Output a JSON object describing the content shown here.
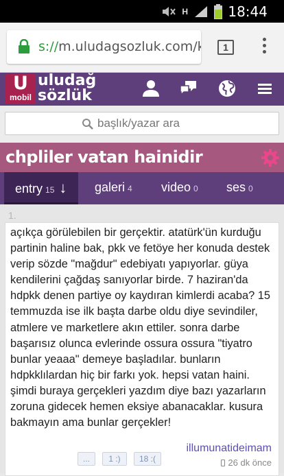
{
  "status_bar": {
    "time": "18:44",
    "network": "H"
  },
  "browser": {
    "url_scheme": "s://",
    "url_rest": "m.uludagsozluk.com/k",
    "tab_count": "1"
  },
  "site": {
    "logo_letter": "U",
    "logo_sub": "mobil",
    "logo_line1": "uludağ",
    "logo_line2": "sözlük"
  },
  "search": {
    "placeholder": "başlık/yazar ara"
  },
  "topic": {
    "title": "chpliler vatan hainidir"
  },
  "tabs": [
    {
      "label": "entry",
      "count": "15",
      "arrow": "↓"
    },
    {
      "label": "galeri",
      "count": "4"
    },
    {
      "label": "video",
      "count": "0"
    },
    {
      "label": "ses",
      "count": "0"
    }
  ],
  "entry": {
    "index": "1.",
    "text": "açıkça görülebilen bir gerçektir. atatürk'ün kurduğu partinin haline bak, pkk ve fetöye her konuda destek verip sözde \"mağdur\" edebiyatı yapıyorlar. güya kendilerini çağdaş sanıyorlar birde. 7 haziran'da hdpkk denen partiye oy kaydıran kimlerdi acaba? 15 temmuzda ise ilk başta darbe oldu diye sevindiler, atmlere ve marketlere akın ettiler. sonra darbe başarısız olunca evlerinde ossura ossura \"tiyatro bunlar yeaaa\" demeye başladılar. bunların hdpkklılardan hiç bir farkı yok. hepsi vatan haini. şimdi buraya gerçekleri yazdım diye bazı yazarların zoruna gidecek hemen eksiye abanacaklar. kusura bakmayın ama bunlar gerçekler!",
    "author": "illumunatideimam",
    "time_ago": "26 dk önce",
    "votes": {
      "more": "...",
      "minus": "1 :)",
      "plus": "18 :("
    }
  },
  "colors": {
    "header": "#5e3f7c",
    "title_bar": "#a6587e",
    "logo": "#a8224f",
    "author": "#5b4fb0"
  }
}
